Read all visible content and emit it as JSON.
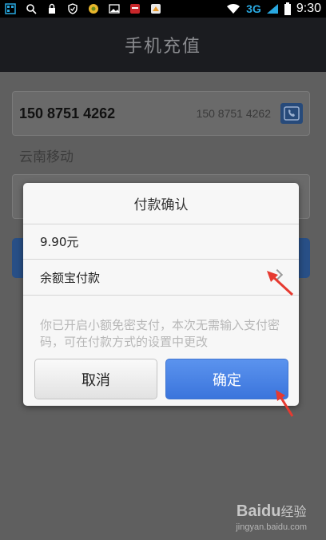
{
  "status_bar": {
    "network": "3G",
    "time": "9:30"
  },
  "header": {
    "title": "手机充值"
  },
  "background": {
    "phone_value": "150 8751 4262",
    "phone_hint": "150 8751 4262",
    "carrier": "云南移动"
  },
  "dialog": {
    "title": "付款确认",
    "amount": "9.90元",
    "payment_method": "余额宝付款",
    "notice": "你已开启小额免密支付，本次无需输入支付密码，可在付款方式的设置中更改",
    "cancel_label": "取消",
    "confirm_label": "确定"
  },
  "watermark": {
    "logo": "Baidu",
    "logo_suffix": "经验",
    "url": "jingyan.baidu.com"
  },
  "colors": {
    "header_bg": "#1b1c20",
    "confirm_button": "#4a84e6",
    "annotation_arrow": "#e63a30",
    "status_3g": "#29a8e0"
  }
}
